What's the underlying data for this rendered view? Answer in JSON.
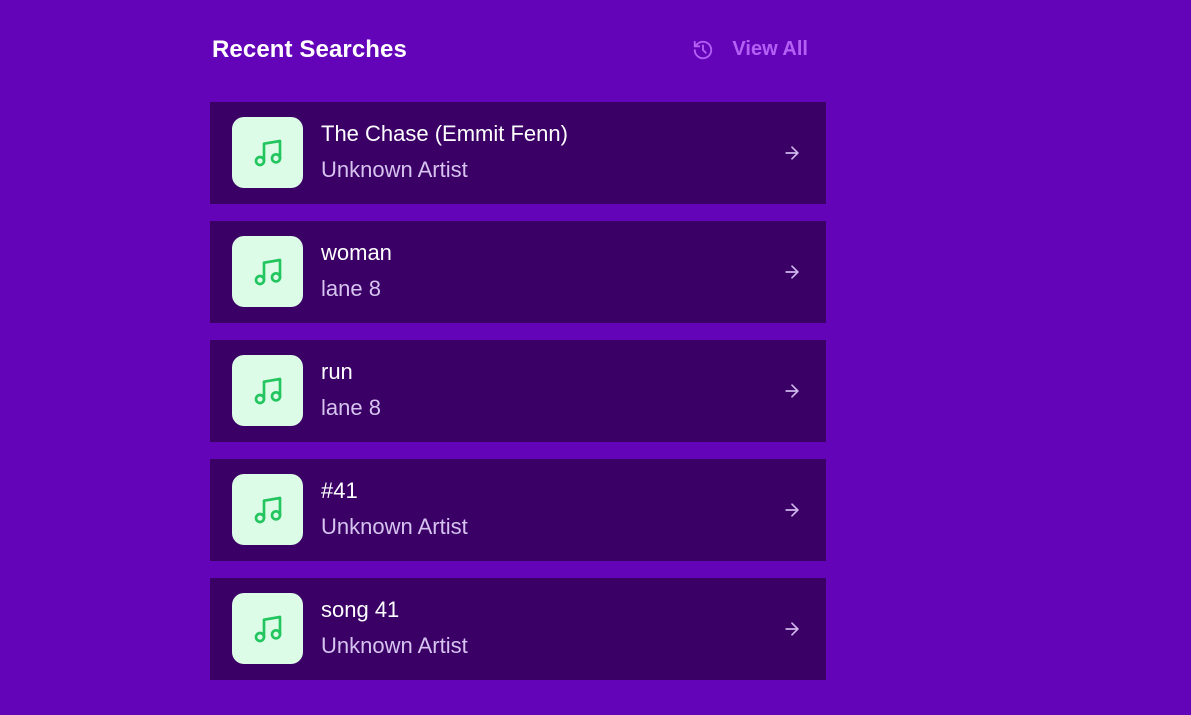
{
  "header": {
    "title": "Recent Searches",
    "view_all_label": "View All",
    "view_all_icon": "history-icon"
  },
  "colors": {
    "background": "#6404b9",
    "row_background": "#3a0066",
    "accent": "#b560f5",
    "thumb_background": "#dcfce7",
    "thumb_icon": "#22c55e"
  },
  "items": [
    {
      "title": "The Chase (Emmit Fenn)",
      "artist": "Unknown Artist",
      "icon": "music-note-icon",
      "action_icon": "arrow-right-icon"
    },
    {
      "title": "woman",
      "artist": "lane 8",
      "icon": "music-note-icon",
      "action_icon": "arrow-right-icon"
    },
    {
      "title": "run",
      "artist": "lane 8",
      "icon": "music-note-icon",
      "action_icon": "arrow-right-icon"
    },
    {
      "title": "#41",
      "artist": "Unknown Artist",
      "icon": "music-note-icon",
      "action_icon": "arrow-right-icon"
    },
    {
      "title": "song 41",
      "artist": "Unknown Artist",
      "icon": "music-note-icon",
      "action_icon": "arrow-right-icon"
    }
  ]
}
